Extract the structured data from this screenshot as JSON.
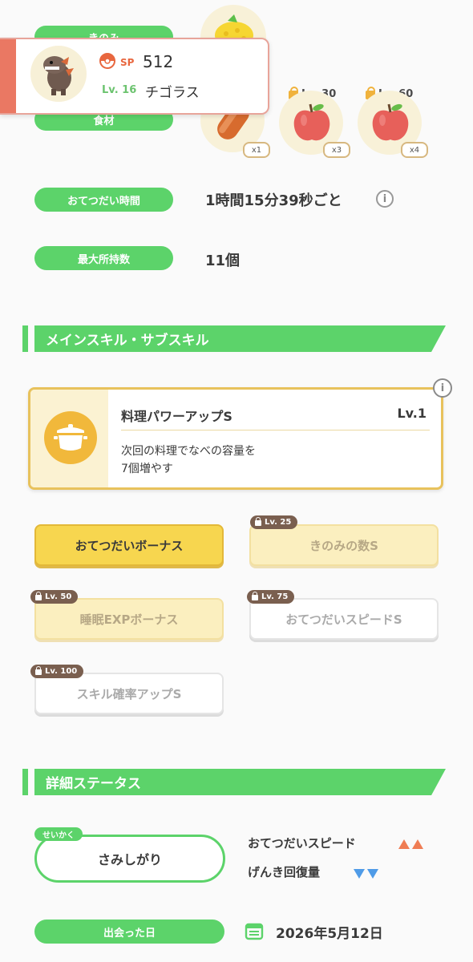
{
  "top": {
    "berry_label": "きのみ",
    "ingredient_label": "食材"
  },
  "popup": {
    "sp_label": "SP",
    "sp_value": "512",
    "level": "Lv. 16",
    "name": "チゴラス"
  },
  "ingredients": [
    {
      "icon": "sausage-icon",
      "qty": "x1",
      "unlock": ""
    },
    {
      "icon": "apple-icon",
      "qty": "x3",
      "unlock": "Lv. 30"
    },
    {
      "icon": "apple-icon",
      "qty": "x4",
      "unlock": "Lv. 60"
    }
  ],
  "help_time": {
    "label": "おてつだい時間",
    "value": "1時間15分39秒ごと"
  },
  "max_carry": {
    "label": "最大所持数",
    "value": "11個"
  },
  "skills_section": {
    "title": "メインスキル・サブスキル"
  },
  "main_skill": {
    "name": "料理パワーアップS",
    "level": "Lv.1",
    "desc_line1": "次回の料理でなべの容量を",
    "desc_line2": "7個増やす"
  },
  "sub_skills": [
    {
      "label": "おてつだいボーナス",
      "lock": ""
    },
    {
      "label": "きのみの数S",
      "lock": "Lv. 25"
    },
    {
      "label": "睡眠EXPボーナス",
      "lock": "Lv. 50"
    },
    {
      "label": "おてつだいスピードS",
      "lock": "Lv. 75"
    },
    {
      "label": "スキル確率アップS",
      "lock": "Lv. 100"
    }
  ],
  "detail_section": {
    "title": "詳細ステータス"
  },
  "nature": {
    "tag": "せいかく",
    "value": "さみしがり",
    "up_stat": "おてつだいスピード",
    "down_stat": "げんき回復量"
  },
  "met_date": {
    "label": "出会った日",
    "value": "2026年5月12日"
  },
  "colors": {
    "accent_green": "#5cd36a",
    "gold": "#f1b83b",
    "up": "#ef7d54",
    "down": "#4f9be7"
  }
}
